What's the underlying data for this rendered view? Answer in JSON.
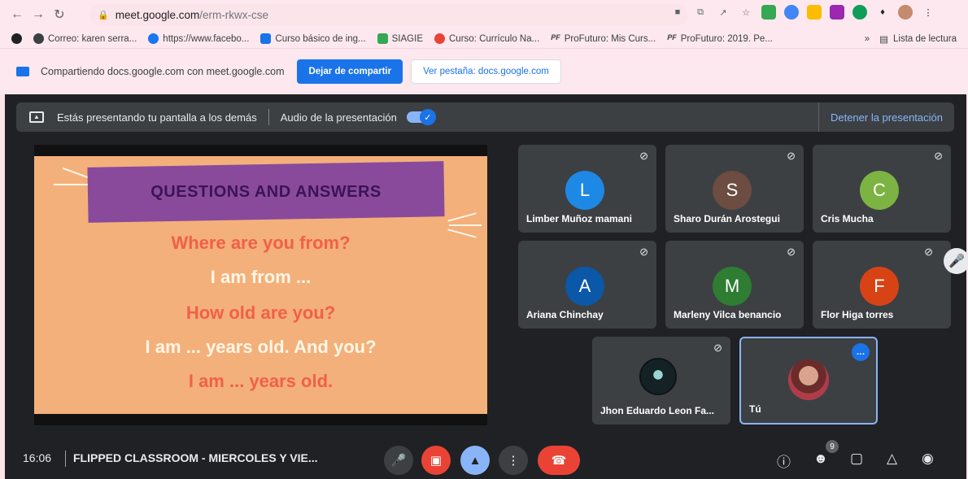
{
  "browser": {
    "url_host": "meet.google.com",
    "url_path": "/erm-rkwx-cse",
    "bookmarks": [
      {
        "label": "Correo: karen serra...",
        "color": "#5f6368"
      },
      {
        "label": "https://www.facebo...",
        "color": "#1877f2"
      },
      {
        "label": "Curso básico de ing...",
        "color": "#1a73e8"
      },
      {
        "label": "SIAGIE",
        "color": "#34a853"
      },
      {
        "label": "Curso: Currículo Na...",
        "color": "#ea4335"
      },
      {
        "label": "ProFuturo: Mis Curs...",
        "color": "#3c4043"
      },
      {
        "label": "ProFuturo: 2019. Pe...",
        "color": "#3c4043"
      }
    ],
    "overflow": "»",
    "reading_list": "Lista de lectura"
  },
  "share_bar": {
    "text": "Compartiendo docs.google.com con meet.google.com",
    "stop_label": "Dejar de compartir",
    "view_label": "Ver pestaña: docs.google.com"
  },
  "present_banner": {
    "text": "Estás presentando tu pantalla a los demás",
    "audio_label": "Audio de la presentación",
    "audio_on": true,
    "stop_label": "Detener la presentación"
  },
  "slide": {
    "title": "QUESTIONS AND ANSWERS",
    "lines": [
      {
        "text": "Where are you from?",
        "color": "#f0604a"
      },
      {
        "text": "I am from ...",
        "color": "#fff6e6"
      },
      {
        "text": "How old are you?",
        "color": "#f0604a"
      },
      {
        "text": "I am ... years old. And you?",
        "color": "#fff6e6"
      },
      {
        "text": "I am ... years old.",
        "color": "#f0604a"
      }
    ]
  },
  "participants": [
    {
      "name": "Limber Muñoz mamani",
      "initial": "L",
      "color": "#1e88e5"
    },
    {
      "name": "Sharo Durán Arostegui",
      "initial": "S",
      "color": "#6d4c41"
    },
    {
      "name": "Cris Mucha",
      "initial": "C",
      "color": "#7cb342"
    },
    {
      "name": "Ariana Chinchay",
      "initial": "A",
      "color": "#0b57a8"
    },
    {
      "name": "Marleny Vilca benancio",
      "initial": "M",
      "color": "#2e7d32"
    },
    {
      "name": "Flor Higa torres",
      "initial": "F",
      "color": "#d84315"
    },
    {
      "name": "Jhon Eduardo Leon Fa...",
      "initial": "",
      "color": "#142225"
    },
    {
      "name": "Tú",
      "initial": "",
      "color": "#b03c4a"
    }
  ],
  "bottom": {
    "time": "16:06",
    "meeting_name": "FLIPPED CLASSROOM - MIERCOLES Y VIE...",
    "participant_count": "9"
  },
  "colors": {
    "meet_bg": "#202124",
    "accent": "#1a73e8",
    "hangup": "#ea4335"
  }
}
